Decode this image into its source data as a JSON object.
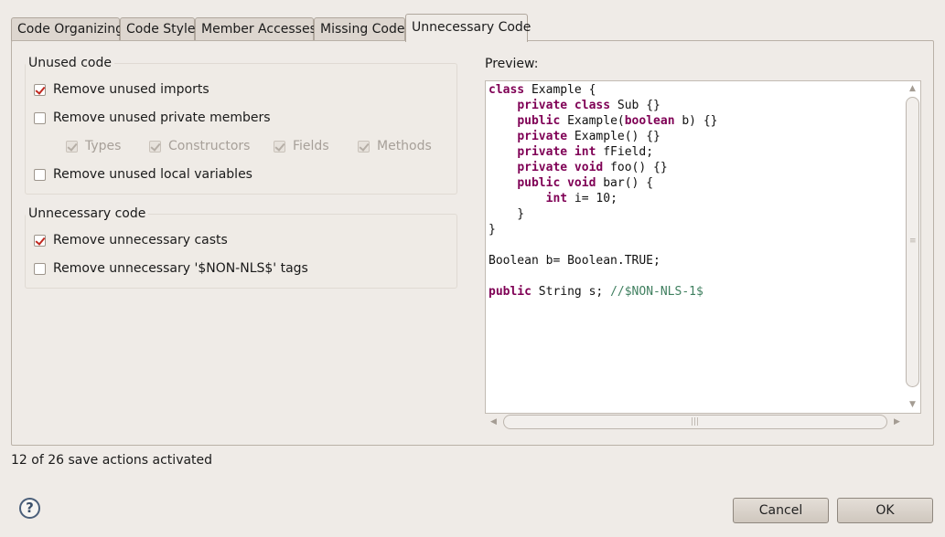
{
  "tabs": [
    {
      "label": "Code Organizing",
      "active": false
    },
    {
      "label": "Code Style",
      "active": false
    },
    {
      "label": "Member Accesses",
      "active": false
    },
    {
      "label": "Missing Code",
      "active": false
    },
    {
      "label": "Unnecessary Code",
      "active": true
    }
  ],
  "unused_code": {
    "title": "Unused code",
    "remove_unused_imports": {
      "label": "Remove unused imports",
      "checked": true
    },
    "remove_unused_private_members": {
      "label": "Remove unused private members",
      "checked": false
    },
    "sub_options": [
      {
        "label": "Types",
        "checked": true,
        "enabled": false
      },
      {
        "label": "Constructors",
        "checked": true,
        "enabled": false
      },
      {
        "label": "Fields",
        "checked": true,
        "enabled": false
      },
      {
        "label": "Methods",
        "checked": true,
        "enabled": false
      }
    ],
    "remove_unused_local_variables": {
      "label": "Remove unused local variables",
      "checked": false
    }
  },
  "unnecessary_code": {
    "title": "Unnecessary code",
    "remove_unnecessary_casts": {
      "label": "Remove unnecessary casts",
      "checked": true
    },
    "remove_unnecessary_nls_tags": {
      "label": "Remove unnecessary '$NON-NLS$' tags",
      "checked": false
    }
  },
  "preview": {
    "label": "Preview:",
    "code_lines": [
      [
        [
          "kw",
          "class"
        ],
        [
          "t",
          " Example {"
        ]
      ],
      [
        [
          "t",
          "    "
        ],
        [
          "kw",
          "private class"
        ],
        [
          "t",
          " Sub {}"
        ]
      ],
      [
        [
          "t",
          "    "
        ],
        [
          "kw",
          "public"
        ],
        [
          "t",
          " Example("
        ],
        [
          "kw",
          "boolean"
        ],
        [
          "t",
          " b) {}"
        ]
      ],
      [
        [
          "t",
          "    "
        ],
        [
          "kw",
          "private"
        ],
        [
          "t",
          " Example() {}"
        ]
      ],
      [
        [
          "t",
          "    "
        ],
        [
          "kw",
          "private int"
        ],
        [
          "t",
          " fField;"
        ]
      ],
      [
        [
          "t",
          "    "
        ],
        [
          "kw",
          "private void"
        ],
        [
          "t",
          " foo() {}"
        ]
      ],
      [
        [
          "t",
          "    "
        ],
        [
          "kw",
          "public void"
        ],
        [
          "t",
          " bar() {"
        ]
      ],
      [
        [
          "t",
          "        "
        ],
        [
          "kw",
          "int"
        ],
        [
          "t",
          " i= 10;"
        ]
      ],
      [
        [
          "t",
          "    }"
        ]
      ],
      [
        [
          "t",
          "}"
        ]
      ],
      [
        [
          "t",
          ""
        ]
      ],
      [
        [
          "t",
          "Boolean b= Boolean.TRUE;"
        ]
      ],
      [
        [
          "t",
          ""
        ]
      ],
      [
        [
          "kw",
          "public"
        ],
        [
          "t",
          " String s; "
        ],
        [
          "cm",
          "//$NON-NLS-1$"
        ]
      ]
    ]
  },
  "status": "12 of 26 save actions activated",
  "buttons": {
    "cancel": "Cancel",
    "ok": "OK"
  },
  "help_glyph": "?",
  "colors": {
    "keyword": "#7f0055",
    "comment": "#3f7f5f",
    "check": "#c0281e"
  }
}
